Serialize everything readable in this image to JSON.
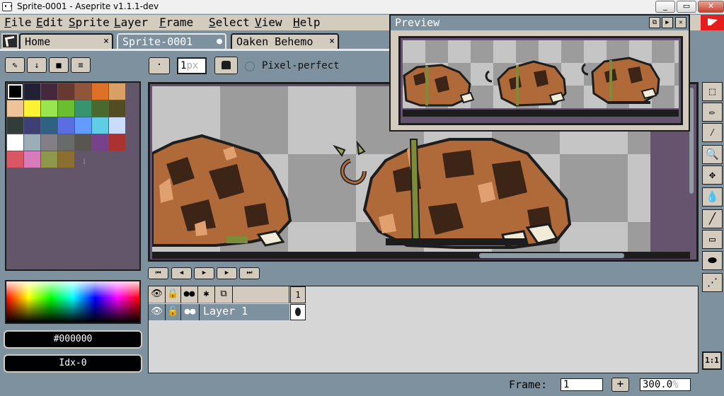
{
  "window": {
    "title": "Sprite-0001 - Aseprite v1.1.1-dev",
    "min_glyph": "_",
    "max_glyph": "▭",
    "close_glyph": "✕"
  },
  "menu": [
    {
      "first": "F",
      "rest": "ile"
    },
    {
      "first": "E",
      "rest": "dit"
    },
    {
      "first": "S",
      "rest": "prite"
    },
    {
      "first": "L",
      "rest": "ayer"
    },
    {
      "first": "F",
      "rest": "rame"
    },
    {
      "first": "S",
      "rest": "elect"
    },
    {
      "first": "V",
      "rest": "iew"
    },
    {
      "first": "H",
      "rest": "elp"
    }
  ],
  "tabs": [
    {
      "label": "Home",
      "close": "×"
    },
    {
      "label": "Sprite-0001",
      "close": "●"
    },
    {
      "label": "Oaken Behemo",
      "close": "×"
    }
  ],
  "palette_buttons": [
    "✎",
    "↓",
    "■",
    "≡"
  ],
  "brush": {
    "shape_glyph": "·",
    "size": "1",
    "size_suffix": "px"
  },
  "pixel_perfect": {
    "label": "Pixel-perfect",
    "checked": false
  },
  "palette": {
    "colors": [
      "#000000",
      "#222034",
      "#45283c",
      "#663931",
      "#8f563b",
      "#df7126",
      "#d9a066",
      "#eec39a",
      "#fbf236",
      "#99e550",
      "#6abe30",
      "#37946e",
      "#4b692f",
      "#524b24",
      "#323c39",
      "#3f3f74",
      "#306082",
      "#5b6ee1",
      "#639bff",
      "#5fcde4",
      "#cbdbfc",
      "#ffffff",
      "#9badb7",
      "#847e87",
      "#696a6a",
      "#595652",
      "#76428a",
      "#ac3232",
      "#d95763",
      "#d77bba",
      "#8f974a",
      "#8a6f30"
    ],
    "resize_glyph": "⁞"
  },
  "color": {
    "hex": "#000000",
    "index": "Idx-0"
  },
  "animation_buttons": [
    "⏮",
    "◀",
    "▶",
    "▶",
    "⏭"
  ],
  "timeline": {
    "header_icons": [
      "👁",
      "🔒",
      "●●",
      "✱",
      "⧉"
    ],
    "frame_number": "1",
    "layer": {
      "visible_glyph": "👁",
      "lock_glyph": "🔓",
      "link_glyph": "●●",
      "name": "Layer 1"
    }
  },
  "tools": [
    "⬚",
    "✏",
    "⁄",
    "🔍",
    "✥",
    "💧",
    "╱",
    "▭",
    "⬬",
    "⋰"
  ],
  "zoom_reset": "1:1",
  "status": {
    "frame_label": "Frame:",
    "frame_value": "1",
    "add_frame": "+",
    "zoom": "300.0",
    "zoom_suffix": "%"
  },
  "preview": {
    "title": "Preview",
    "buttons": [
      "⧉",
      "▶",
      "✕"
    ]
  },
  "colors": {
    "ui_gray": "#7d929e",
    "ui_beige": "#d3cbbe",
    "canvas_bg": "#66546e",
    "boar_brown": "#b06a3a",
    "boar_dark": "#3c2417"
  }
}
